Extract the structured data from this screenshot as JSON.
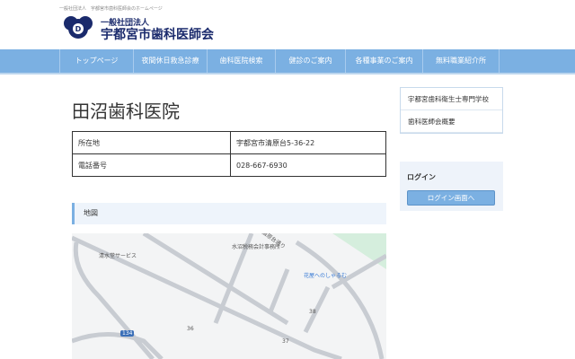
{
  "header": {
    "tagline": "一般社団法人　宇都宮市歯科医師会のホームページ",
    "org_small": "一般社団法人",
    "org_name": "宇都宮市歯科医師会"
  },
  "nav": [
    "トップページ",
    "夜間休日救急診療",
    "歯科医院検索",
    "健診のご案内",
    "各種事業のご案内",
    "無料職業紹介所"
  ],
  "page": {
    "title": "田沼歯科医院",
    "rows": [
      {
        "label": "所在地",
        "value": "宇都宮市清原台5-36-22"
      },
      {
        "label": "電話番号",
        "value": "028-667-6930"
      }
    ],
    "map_heading": "地図"
  },
  "map": {
    "labels": [
      "水沼税務会計事務所",
      "清水堂サービス",
      "清原台通り",
      "花屋へのしゃるむ",
      "38",
      "36",
      "37",
      "134"
    ]
  },
  "sidebar": {
    "links": [
      "宇都宮歯科衛生士専門学校",
      "歯科医師会概要"
    ],
    "login_title": "ログイン",
    "login_button": "ログイン画面へ"
  },
  "colors": {
    "nav": "#7bb0e2",
    "brand": "#1a2a6c"
  }
}
